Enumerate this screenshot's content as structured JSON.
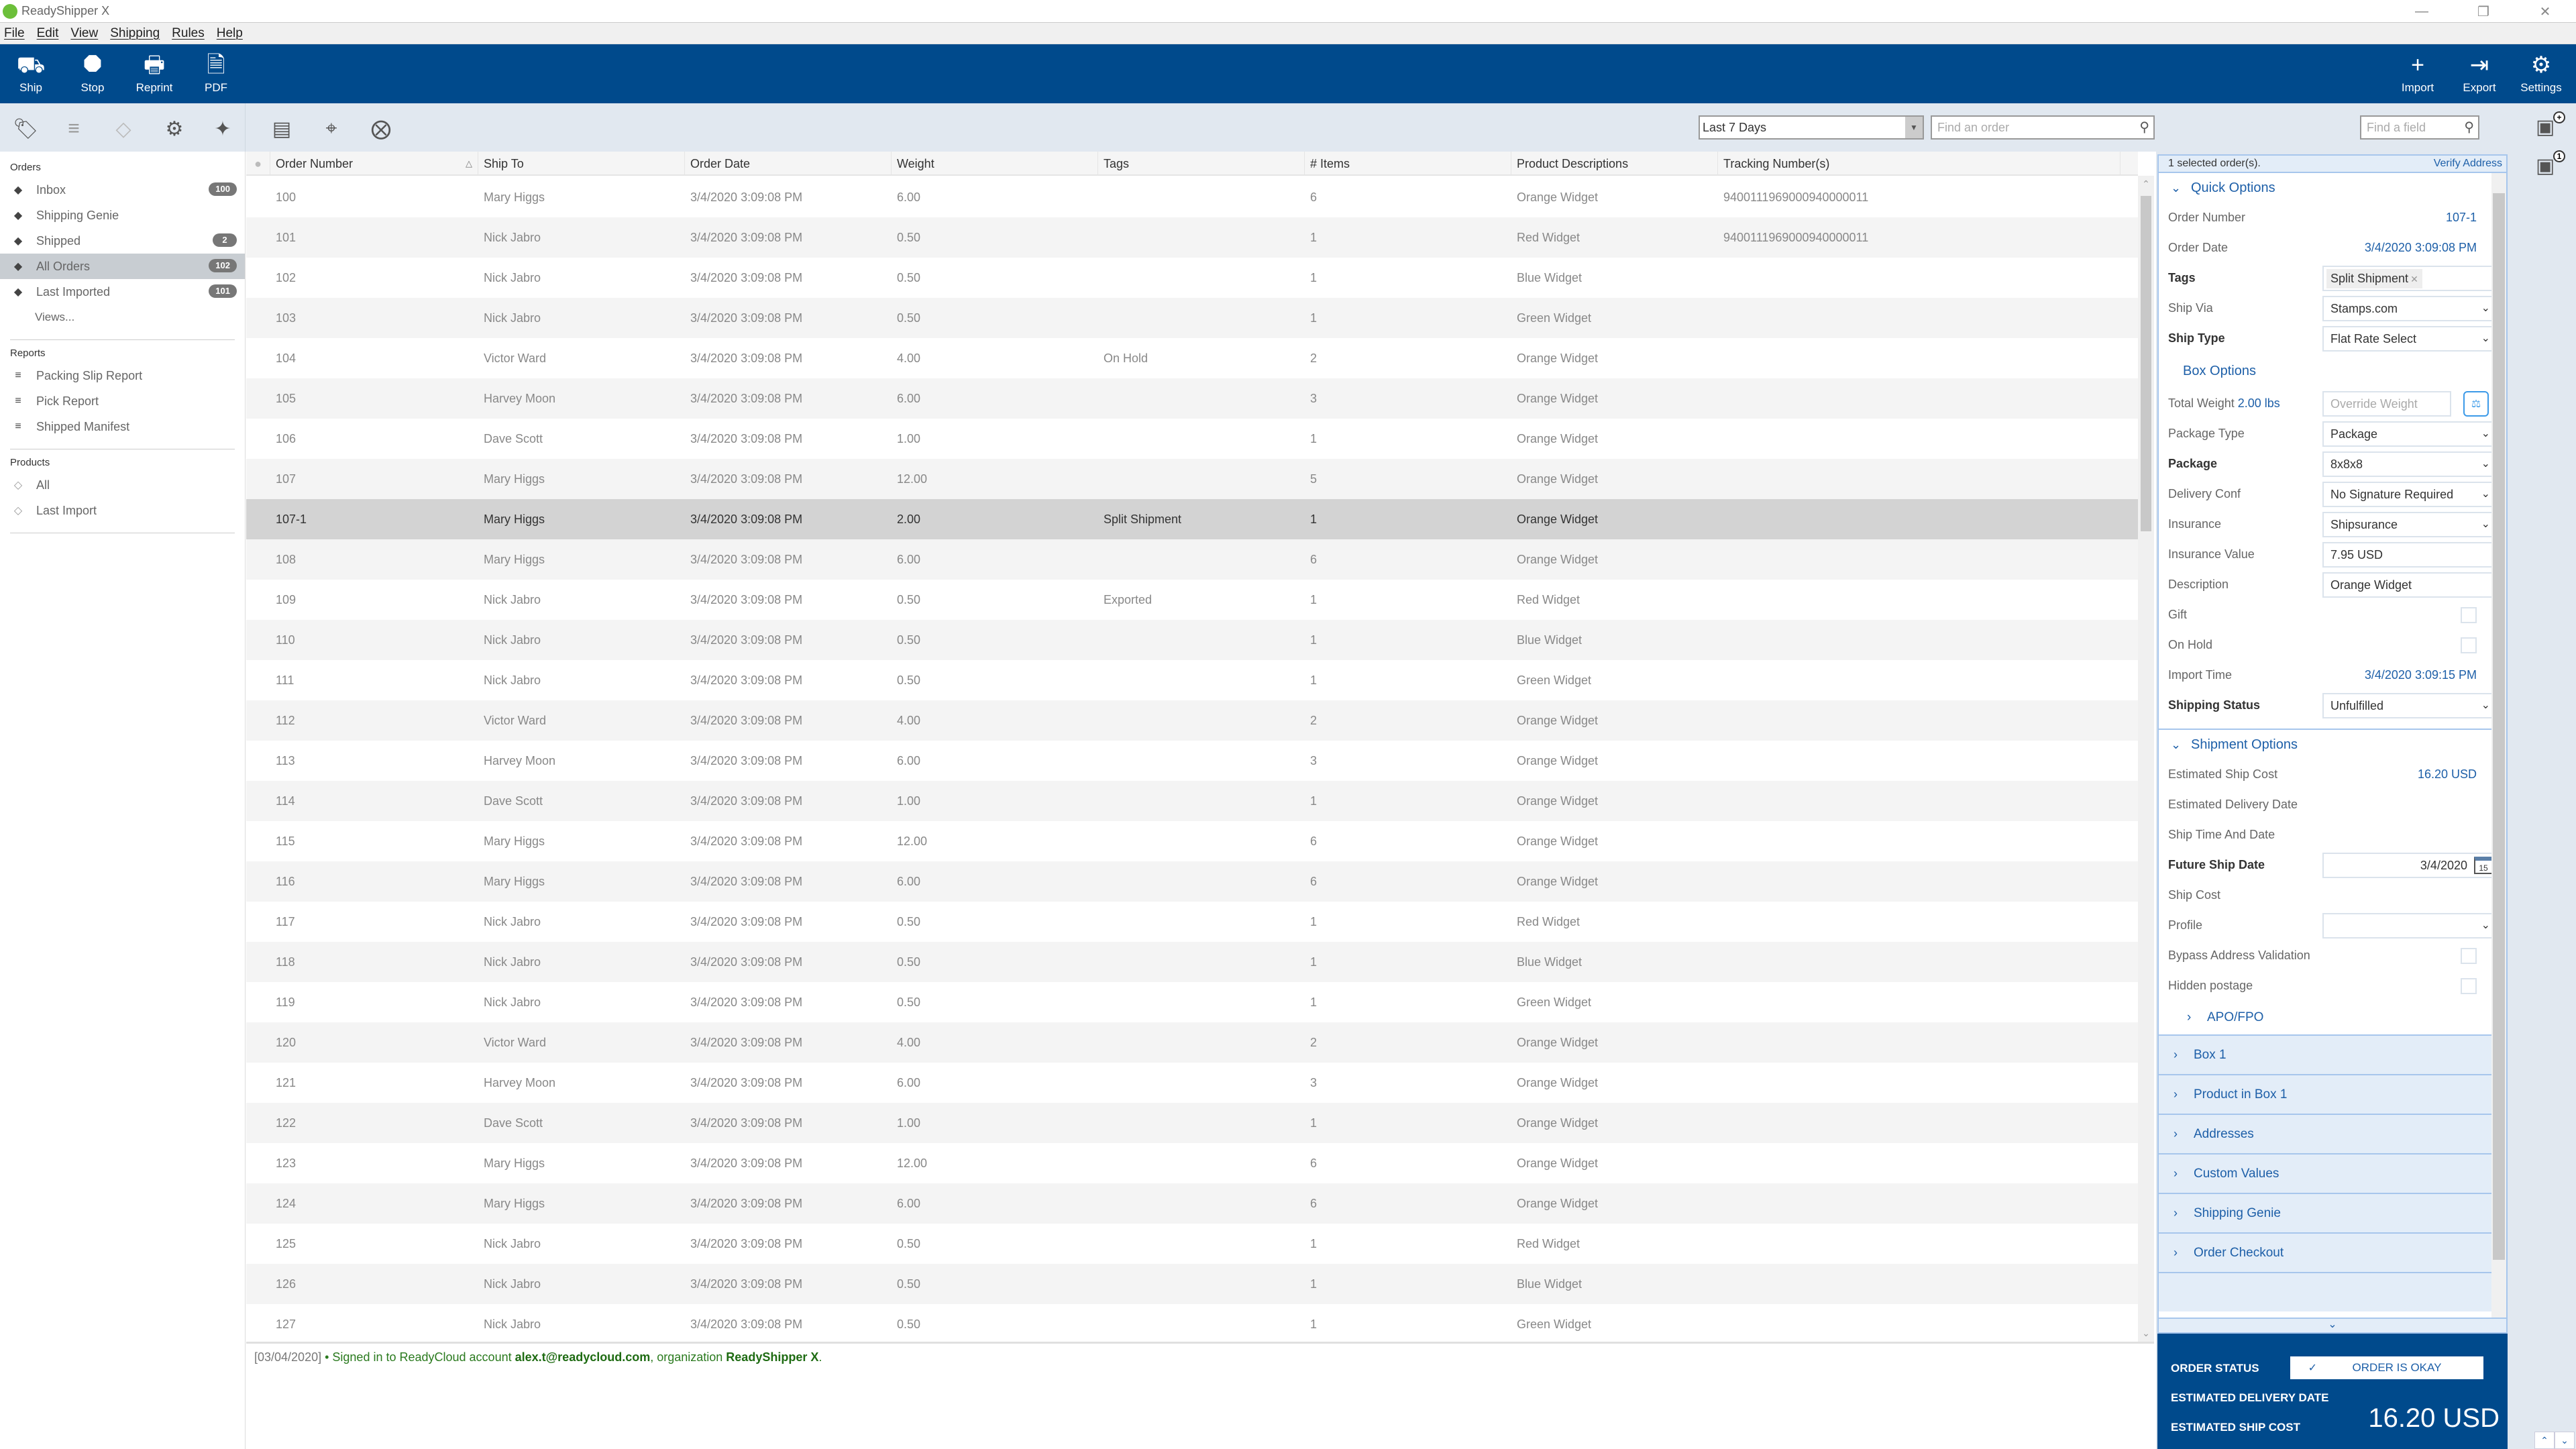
{
  "window": {
    "title": "ReadyShipper X",
    "controls": [
      "minimize",
      "restore",
      "close"
    ]
  },
  "menu": [
    "File",
    "Edit",
    "View",
    "Shipping",
    "Rules",
    "Help"
  ],
  "ribbon": {
    "left": [
      {
        "label": "Ship",
        "icon": "truck-icon"
      },
      {
        "label": "Stop",
        "icon": "stop-icon"
      },
      {
        "label": "Reprint",
        "icon": "printer-icon"
      },
      {
        "label": "PDF",
        "icon": "pdf-export-icon"
      }
    ],
    "right": [
      {
        "label": "Import",
        "icon": "plus-icon"
      },
      {
        "label": "Export",
        "icon": "export-icon"
      },
      {
        "label": "Settings",
        "icon": "gear-icon"
      }
    ]
  },
  "toolbar": {
    "icons": [
      "tag-icon",
      "report-lines-icon",
      "product-tag-icon",
      "gears-icon",
      "magic-wand-icon",
      "document-icon",
      "crosshair-icon",
      "close-circle-icon"
    ],
    "date_filter": "Last 7 Days",
    "find_order_placeholder": "Find an order",
    "find_field_placeholder": "Find a field"
  },
  "sidebar": {
    "orders_header": "Orders",
    "orders": [
      {
        "label": "Inbox",
        "count": "100"
      },
      {
        "label": "Shipping Genie",
        "count": ""
      },
      {
        "label": "Shipped",
        "count": "2"
      },
      {
        "label": "All Orders",
        "count": "102",
        "active": true
      },
      {
        "label": "Last Imported",
        "count": "101"
      }
    ],
    "views_label": "Views...",
    "reports_header": "Reports",
    "reports": [
      "Packing Slip Report",
      "Pick Report",
      "Shipped Manifest"
    ],
    "products_header": "Products",
    "products": [
      "All",
      "Last Import"
    ]
  },
  "grid": {
    "columns": [
      "Order Number",
      "Ship To",
      "Order Date",
      "Weight",
      "Tags",
      "# Items",
      "Product Descriptions",
      "Tracking Number(s)"
    ],
    "sort_column": "Order Number",
    "sort_direction": "ascending",
    "selected_order": "107-1",
    "rows": [
      {
        "order": "100",
        "ship_to": "Mary Higgs",
        "date": "3/4/2020 3:09:08 PM",
        "weight": "6.00",
        "tags": "",
        "items": "6",
        "product": "Orange Widget",
        "tracking": "9400111969000940000011"
      },
      {
        "order": "101",
        "ship_to": "Nick Jabro",
        "date": "3/4/2020 3:09:08 PM",
        "weight": "0.50",
        "tags": "",
        "items": "1",
        "product": "Red Widget",
        "tracking": "9400111969000940000011"
      },
      {
        "order": "102",
        "ship_to": "Nick Jabro",
        "date": "3/4/2020 3:09:08 PM",
        "weight": "0.50",
        "tags": "",
        "items": "1",
        "product": "Blue Widget",
        "tracking": ""
      },
      {
        "order": "103",
        "ship_to": "Nick Jabro",
        "date": "3/4/2020 3:09:08 PM",
        "weight": "0.50",
        "tags": "",
        "items": "1",
        "product": "Green Widget",
        "tracking": ""
      },
      {
        "order": "104",
        "ship_to": "Victor Ward",
        "date": "3/4/2020 3:09:08 PM",
        "weight": "4.00",
        "tags": "On Hold",
        "items": "2",
        "product": "Orange Widget",
        "tracking": ""
      },
      {
        "order": "105",
        "ship_to": "Harvey Moon",
        "date": "3/4/2020 3:09:08 PM",
        "weight": "6.00",
        "tags": "",
        "items": "3",
        "product": "Orange Widget",
        "tracking": ""
      },
      {
        "order": "106",
        "ship_to": "Dave Scott",
        "date": "3/4/2020 3:09:08 PM",
        "weight": "1.00",
        "tags": "",
        "items": "1",
        "product": "Orange Widget",
        "tracking": ""
      },
      {
        "order": "107",
        "ship_to": "Mary Higgs",
        "date": "3/4/2020 3:09:08 PM",
        "weight": "12.00",
        "tags": "",
        "items": "5",
        "product": "Orange Widget",
        "tracking": ""
      },
      {
        "order": "107-1",
        "ship_to": "Mary Higgs",
        "date": "3/4/2020 3:09:08 PM",
        "weight": "2.00",
        "tags": "Split Shipment",
        "items": "1",
        "product": "Orange Widget",
        "tracking": ""
      },
      {
        "order": "108",
        "ship_to": "Mary Higgs",
        "date": "3/4/2020 3:09:08 PM",
        "weight": "6.00",
        "tags": "",
        "items": "6",
        "product": "Orange Widget",
        "tracking": ""
      },
      {
        "order": "109",
        "ship_to": "Nick Jabro",
        "date": "3/4/2020 3:09:08 PM",
        "weight": "0.50",
        "tags": "Exported",
        "items": "1",
        "product": "Red Widget",
        "tracking": ""
      },
      {
        "order": "110",
        "ship_to": "Nick Jabro",
        "date": "3/4/2020 3:09:08 PM",
        "weight": "0.50",
        "tags": "",
        "items": "1",
        "product": "Blue Widget",
        "tracking": ""
      },
      {
        "order": "111",
        "ship_to": "Nick Jabro",
        "date": "3/4/2020 3:09:08 PM",
        "weight": "0.50",
        "tags": "",
        "items": "1",
        "product": "Green Widget",
        "tracking": ""
      },
      {
        "order": "112",
        "ship_to": "Victor Ward",
        "date": "3/4/2020 3:09:08 PM",
        "weight": "4.00",
        "tags": "",
        "items": "2",
        "product": "Orange Widget",
        "tracking": ""
      },
      {
        "order": "113",
        "ship_to": "Harvey Moon",
        "date": "3/4/2020 3:09:08 PM",
        "weight": "6.00",
        "tags": "",
        "items": "3",
        "product": "Orange Widget",
        "tracking": ""
      },
      {
        "order": "114",
        "ship_to": "Dave Scott",
        "date": "3/4/2020 3:09:08 PM",
        "weight": "1.00",
        "tags": "",
        "items": "1",
        "product": "Orange Widget",
        "tracking": ""
      },
      {
        "order": "115",
        "ship_to": "Mary Higgs",
        "date": "3/4/2020 3:09:08 PM",
        "weight": "12.00",
        "tags": "",
        "items": "6",
        "product": "Orange Widget",
        "tracking": ""
      },
      {
        "order": "116",
        "ship_to": "Mary Higgs",
        "date": "3/4/2020 3:09:08 PM",
        "weight": "6.00",
        "tags": "",
        "items": "6",
        "product": "Orange Widget",
        "tracking": ""
      },
      {
        "order": "117",
        "ship_to": "Nick Jabro",
        "date": "3/4/2020 3:09:08 PM",
        "weight": "0.50",
        "tags": "",
        "items": "1",
        "product": "Red Widget",
        "tracking": ""
      },
      {
        "order": "118",
        "ship_to": "Nick Jabro",
        "date": "3/4/2020 3:09:08 PM",
        "weight": "0.50",
        "tags": "",
        "items": "1",
        "product": "Blue Widget",
        "tracking": ""
      },
      {
        "order": "119",
        "ship_to": "Nick Jabro",
        "date": "3/4/2020 3:09:08 PM",
        "weight": "0.50",
        "tags": "",
        "items": "1",
        "product": "Green Widget",
        "tracking": ""
      },
      {
        "order": "120",
        "ship_to": "Victor Ward",
        "date": "3/4/2020 3:09:08 PM",
        "weight": "4.00",
        "tags": "",
        "items": "2",
        "product": "Orange Widget",
        "tracking": ""
      },
      {
        "order": "121",
        "ship_to": "Harvey Moon",
        "date": "3/4/2020 3:09:08 PM",
        "weight": "6.00",
        "tags": "",
        "items": "3",
        "product": "Orange Widget",
        "tracking": ""
      },
      {
        "order": "122",
        "ship_to": "Dave Scott",
        "date": "3/4/2020 3:09:08 PM",
        "weight": "1.00",
        "tags": "",
        "items": "1",
        "product": "Orange Widget",
        "tracking": ""
      },
      {
        "order": "123",
        "ship_to": "Mary Higgs",
        "date": "3/4/2020 3:09:08 PM",
        "weight": "12.00",
        "tags": "",
        "items": "6",
        "product": "Orange Widget",
        "tracking": ""
      },
      {
        "order": "124",
        "ship_to": "Mary Higgs",
        "date": "3/4/2020 3:09:08 PM",
        "weight": "6.00",
        "tags": "",
        "items": "6",
        "product": "Orange Widget",
        "tracking": ""
      },
      {
        "order": "125",
        "ship_to": "Nick Jabro",
        "date": "3/4/2020 3:09:08 PM",
        "weight": "0.50",
        "tags": "",
        "items": "1",
        "product": "Red Widget",
        "tracking": ""
      },
      {
        "order": "126",
        "ship_to": "Nick Jabro",
        "date": "3/4/2020 3:09:08 PM",
        "weight": "0.50",
        "tags": "",
        "items": "1",
        "product": "Blue Widget",
        "tracking": ""
      },
      {
        "order": "127",
        "ship_to": "Nick Jabro",
        "date": "3/4/2020 3:09:08 PM",
        "weight": "0.50",
        "tags": "",
        "items": "1",
        "product": "Green Widget",
        "tracking": ""
      }
    ]
  },
  "log": {
    "date": "[03/04/2020]",
    "bullet": " • ",
    "message": "Signed in to ReadyCloud account ",
    "account": "alex.t@readycloud.com",
    "middle": ", organization ",
    "organization": "ReadyShipper X",
    "end": "."
  },
  "details": {
    "selected_text": "1 selected order(s).",
    "verify_address": "Verify Address",
    "quick_options": {
      "title": "Quick Options",
      "order_number_label": "Order Number",
      "order_number": "107-1",
      "order_date_label": "Order Date",
      "order_date": "3/4/2020 3:09:08 PM",
      "tags_label": "Tags",
      "tag": "Split Shipment",
      "ship_via_label": "Ship Via",
      "ship_via": "Stamps.com",
      "ship_type_label": "Ship Type",
      "ship_type": "Flat Rate Select"
    },
    "box_options": {
      "title": "Box Options",
      "total_weight_label": "Total Weight",
      "total_weight": "2.00 lbs",
      "override_weight_placeholder": "Override Weight",
      "package_type_label": "Package Type",
      "package_type": "Package",
      "package_label": "Package",
      "package": "8x8x8",
      "delivery_conf_label": "Delivery Conf",
      "delivery_conf": "No Signature Required",
      "insurance_label": "Insurance",
      "insurance": "Shipsurance",
      "insurance_value_label": "Insurance Value",
      "insurance_value": "7.95 USD",
      "description_label": "Description",
      "description": "Orange Widget",
      "gift_label": "Gift",
      "gift": false,
      "on_hold_label": "On Hold",
      "on_hold": false,
      "import_time_label": "Import Time",
      "import_time": "3/4/2020 3:09:15 PM",
      "shipping_status_label": "Shipping Status",
      "shipping_status": "Unfulfilled"
    },
    "shipment_options": {
      "title": "Shipment Options",
      "est_ship_cost_label": "Estimated Ship Cost",
      "est_ship_cost": "16.20 USD",
      "est_delivery_label": "Estimated Delivery Date",
      "est_delivery": "",
      "ship_time_label": "Ship Time And Date",
      "future_ship_date_label": "Future Ship Date",
      "future_ship_date": "3/4/2020",
      "calendar_day": "15",
      "ship_cost_label": "Ship Cost",
      "profile_label": "Profile",
      "profile": "",
      "bypass_label": "Bypass Address Validation",
      "bypass": false,
      "hidden_postage_label": "Hidden postage",
      "hidden_postage": false,
      "apo_label": "APO/FPO"
    },
    "collapsed_sections": [
      "Box 1",
      "Product in Box 1",
      "Addresses",
      "Custom Values",
      "Shipping Genie",
      "Order Checkout"
    ],
    "summary": {
      "order_status_label": "ORDER STATUS",
      "order_status": "ORDER IS OKAY",
      "est_delivery_label": "ESTIMATED DELIVERY DATE",
      "est_cost_label": "ESTIMATED SHIP COST",
      "est_cost": "16.20 USD"
    }
  },
  "colors": {
    "brand_blue": "#004a8c",
    "link_blue": "#1d5fa8",
    "toolbar_bg": "#e1e8f0",
    "selected_row": "#d3d3d3",
    "log_green": "#2a7a1e"
  }
}
